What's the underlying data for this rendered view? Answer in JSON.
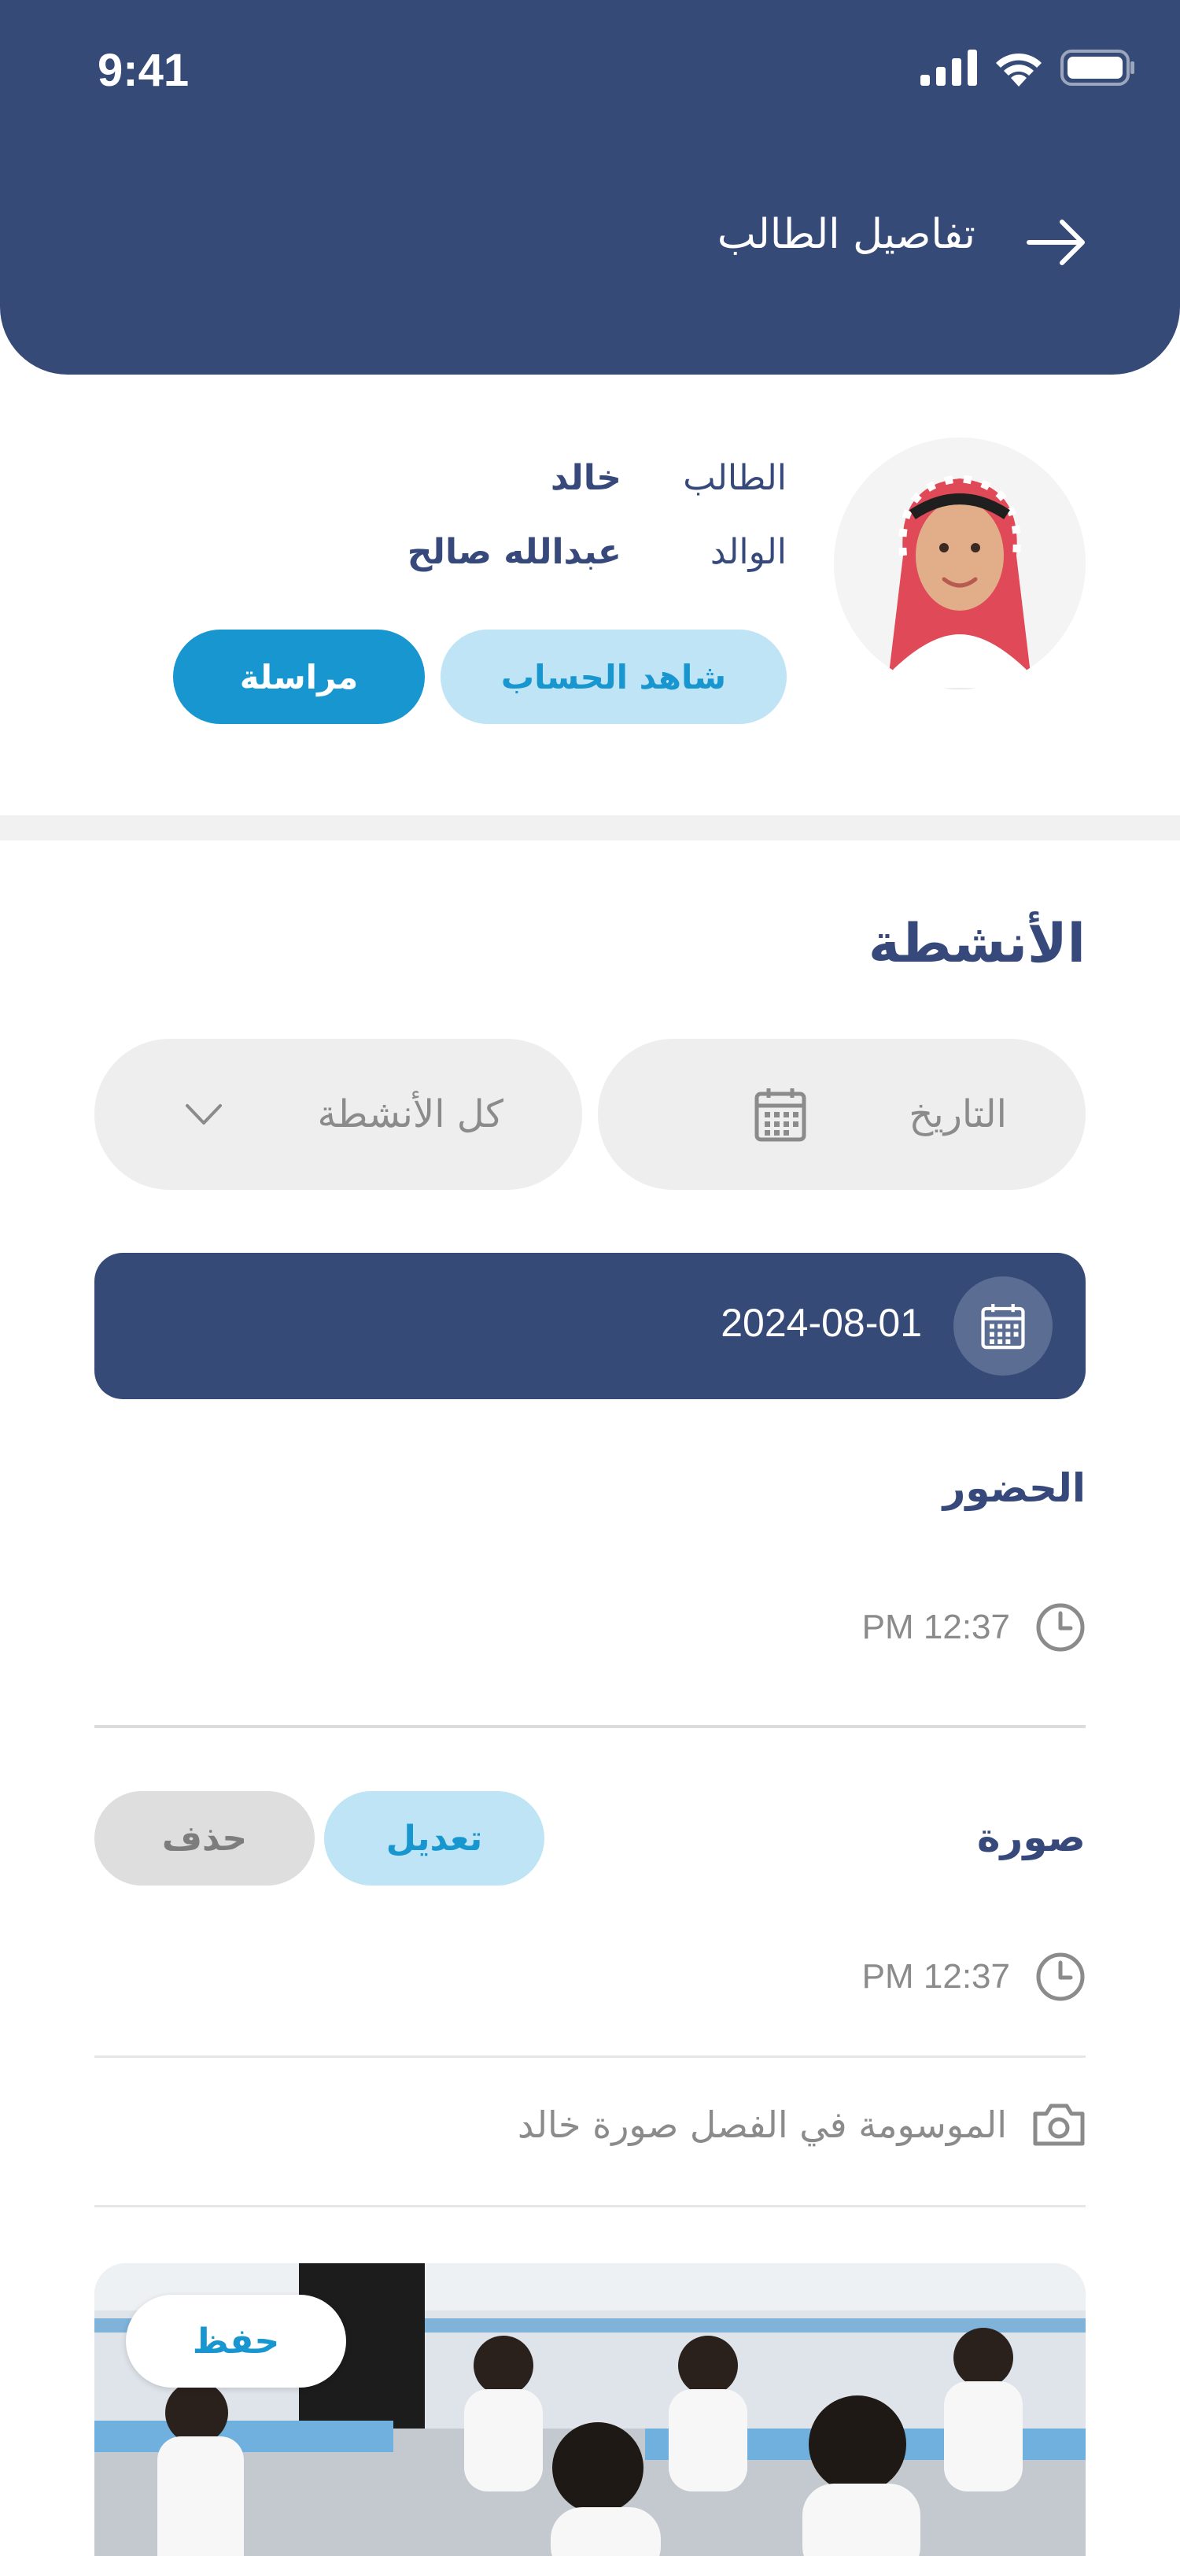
{
  "status_bar": {
    "time": "9:41"
  },
  "header": {
    "title": "تفاصيل الطالب"
  },
  "profile": {
    "student_label": "الطالب",
    "student_name": "خالد",
    "parent_label": "الوالد",
    "parent_name": "عبدالله صالح",
    "view_account_label": "شاهد الحساب",
    "message_label": "مراسلة"
  },
  "activities": {
    "title": "الأنشطة",
    "date_filter_placeholder": "التاريخ",
    "type_filter_value": "كل الأنشطة",
    "selected_date": "2024-08-01",
    "items": [
      {
        "title": "الحضور",
        "time": "12:37 PM"
      },
      {
        "title": "صورة",
        "time": "12:37 PM",
        "edit_label": "تعديل",
        "delete_label": "حذف",
        "caption": "الموسومة في الفصل صورة خالد",
        "save_label": "حفظ"
      }
    ]
  },
  "colors": {
    "primary": "#364a78",
    "accent": "#1896cf",
    "accent_light": "#bee4f5"
  }
}
